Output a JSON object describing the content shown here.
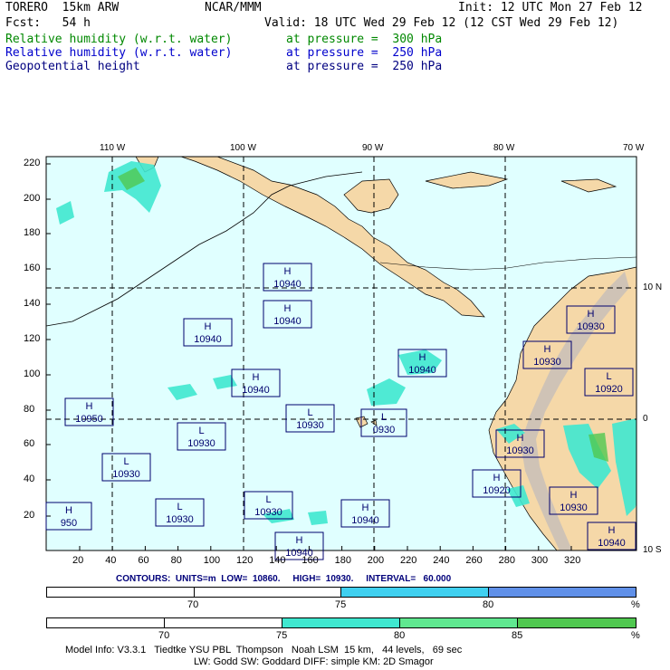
{
  "header": {
    "model": "TORERO  15km ARW",
    "center": "NCAR/MMM",
    "init": "Init: 12 UTC Mon 27 Feb 12",
    "fcst": "Fcst:   54 h",
    "valid": "Valid: 18 UTC Wed 29 Feb 12 (12 CST Wed 29 Feb 12)"
  },
  "fields": [
    {
      "name": "Relative humidity (w.r.t. water)",
      "level": "at pressure =  300 hPa",
      "color": "#008800"
    },
    {
      "name": "Relative humidity (w.r.t. water)",
      "level": "at pressure =  250 hPa",
      "color": "#0000cc"
    },
    {
      "name": "Geopotential height",
      "level": "at pressure =  250 hPa",
      "color": "#000080"
    }
  ],
  "lon_labels": [
    "110 W",
    "100 W",
    "90 W",
    "80 W",
    "70 W"
  ],
  "lat_labels": [
    "10 N",
    "0",
    "10 S"
  ],
  "y_ticks": [
    "220",
    "200",
    "180",
    "160",
    "140",
    "120",
    "100",
    "80",
    "60",
    "40",
    "20"
  ],
  "x_ticks": [
    "20",
    "40",
    "60",
    "80",
    "100",
    "120",
    "140",
    "160",
    "180",
    "200",
    "220",
    "240",
    "260",
    "280",
    "300",
    "320"
  ],
  "pressure_centers": [
    {
      "type": "H",
      "value": "10940"
    },
    {
      "type": "H",
      "value": "10940"
    },
    {
      "type": "H",
      "value": "10940"
    },
    {
      "type": "H",
      "value": "10940"
    },
    {
      "type": "H",
      "value": "10940"
    },
    {
      "type": "H",
      "value": "10950"
    },
    {
      "type": "L",
      "value": "10930"
    },
    {
      "type": "L",
      "value": "10930"
    },
    {
      "type": "L",
      "value": "0930"
    },
    {
      "type": "L",
      "value": "10930"
    },
    {
      "type": "L",
      "value": "10930"
    },
    {
      "type": "L",
      "value": "10930"
    },
    {
      "type": "H",
      "value": "10940"
    },
    {
      "type": "H",
      "value": "950"
    },
    {
      "type": "H",
      "value": "10930"
    },
    {
      "type": "H",
      "value": "10930"
    },
    {
      "type": "H",
      "value": "10930"
    },
    {
      "type": "L",
      "value": "10920"
    },
    {
      "type": "H",
      "value": "10920"
    },
    {
      "type": "H",
      "value": "10930"
    },
    {
      "type": "H",
      "value": "10940"
    },
    {
      "type": "H",
      "value": "10940"
    }
  ],
  "contour_info": "CONTOURS:  UNITS=m  LOW=  10860.     HIGH=  10930.     INTERVAL=   60.000",
  "colorbar1": {
    "segments": [
      {
        "color": "#ffffff"
      },
      {
        "color": "#ffffff"
      },
      {
        "color": "#40d0f0"
      },
      {
        "color": "#6090e8"
      }
    ],
    "labels": [
      "70",
      "75",
      "80",
      "%"
    ]
  },
  "colorbar2": {
    "segments": [
      {
        "color": "#ffffff"
      },
      {
        "color": "#ffffff"
      },
      {
        "color": "#40e8d0"
      },
      {
        "color": "#60e890"
      },
      {
        "color": "#50c850"
      }
    ],
    "labels": [
      "70",
      "75",
      "80",
      "85",
      "%"
    ]
  },
  "footer": {
    "line1": "Model Info: V3.3.1   Tiedtke YSU PBL  Thompson   Noah LSM  15 km,   44 levels,   69 sec",
    "line2": "LW: Godd SW: Goddard DIFF: simple KM: 2D Smagor"
  },
  "colors": {
    "ocean": "#e0ffff",
    "land": "#f5d8a8",
    "mountain": "#c0b8b0",
    "box": "#00006e"
  }
}
